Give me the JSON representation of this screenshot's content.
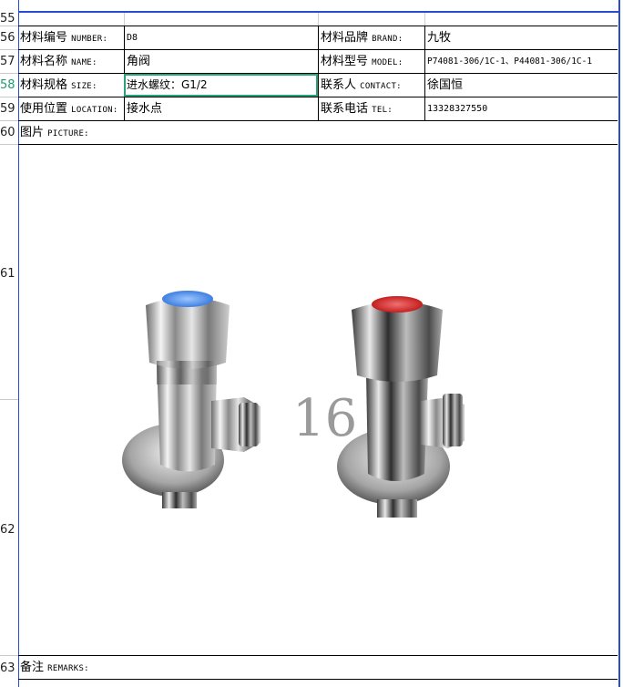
{
  "rows": [
    {
      "num": "55",
      "active": false
    },
    {
      "num": "56",
      "active": false
    },
    {
      "num": "57",
      "active": false
    },
    {
      "num": "58",
      "active": true
    },
    {
      "num": "59",
      "active": false
    },
    {
      "num": "60",
      "active": false
    },
    {
      "num": "61",
      "active": false
    },
    {
      "num": "62",
      "active": false
    },
    {
      "num": "63",
      "active": false
    }
  ],
  "fields": {
    "number": {
      "label_cn": "材料编号",
      "label_en": "NUMBER:",
      "value": "D8"
    },
    "brand": {
      "label_cn": "材料品牌",
      "label_en": "BRAND:",
      "value": "九牧"
    },
    "name": {
      "label_cn": "材料名称",
      "label_en": "NAME:",
      "value": "角阀"
    },
    "model": {
      "label_cn": "材料型号",
      "label_en": "MODEL:",
      "value": "P74081-306/1C-1、P44081-306/1C-1"
    },
    "size": {
      "label_cn": "材料规格",
      "label_en": "SIZE:",
      "value": "进水螺纹：G1/2"
    },
    "contact": {
      "label_cn": "联系人",
      "label_en": "CONTACT:",
      "value": "徐国恒"
    },
    "location": {
      "label_cn": "使用位置",
      "label_en": "LOCATION:",
      "value": "接水点"
    },
    "tel": {
      "label_cn": "联系电话",
      "label_en": "TEL:",
      "value": "13328327550"
    }
  },
  "picture": {
    "label_cn": "图片",
    "label_en": "PICTURE:",
    "watermark": "16"
  },
  "remarks": {
    "label_cn": "备注",
    "label_en": "REMARKS:"
  },
  "colors": {
    "grid_border": "#2a4bd7",
    "selection": "#27a37a",
    "active_row_number": "#1e9a73",
    "left_valve_handle_cap": "#3f7fe0",
    "right_valve_handle_cap": "#c41f1f"
  }
}
